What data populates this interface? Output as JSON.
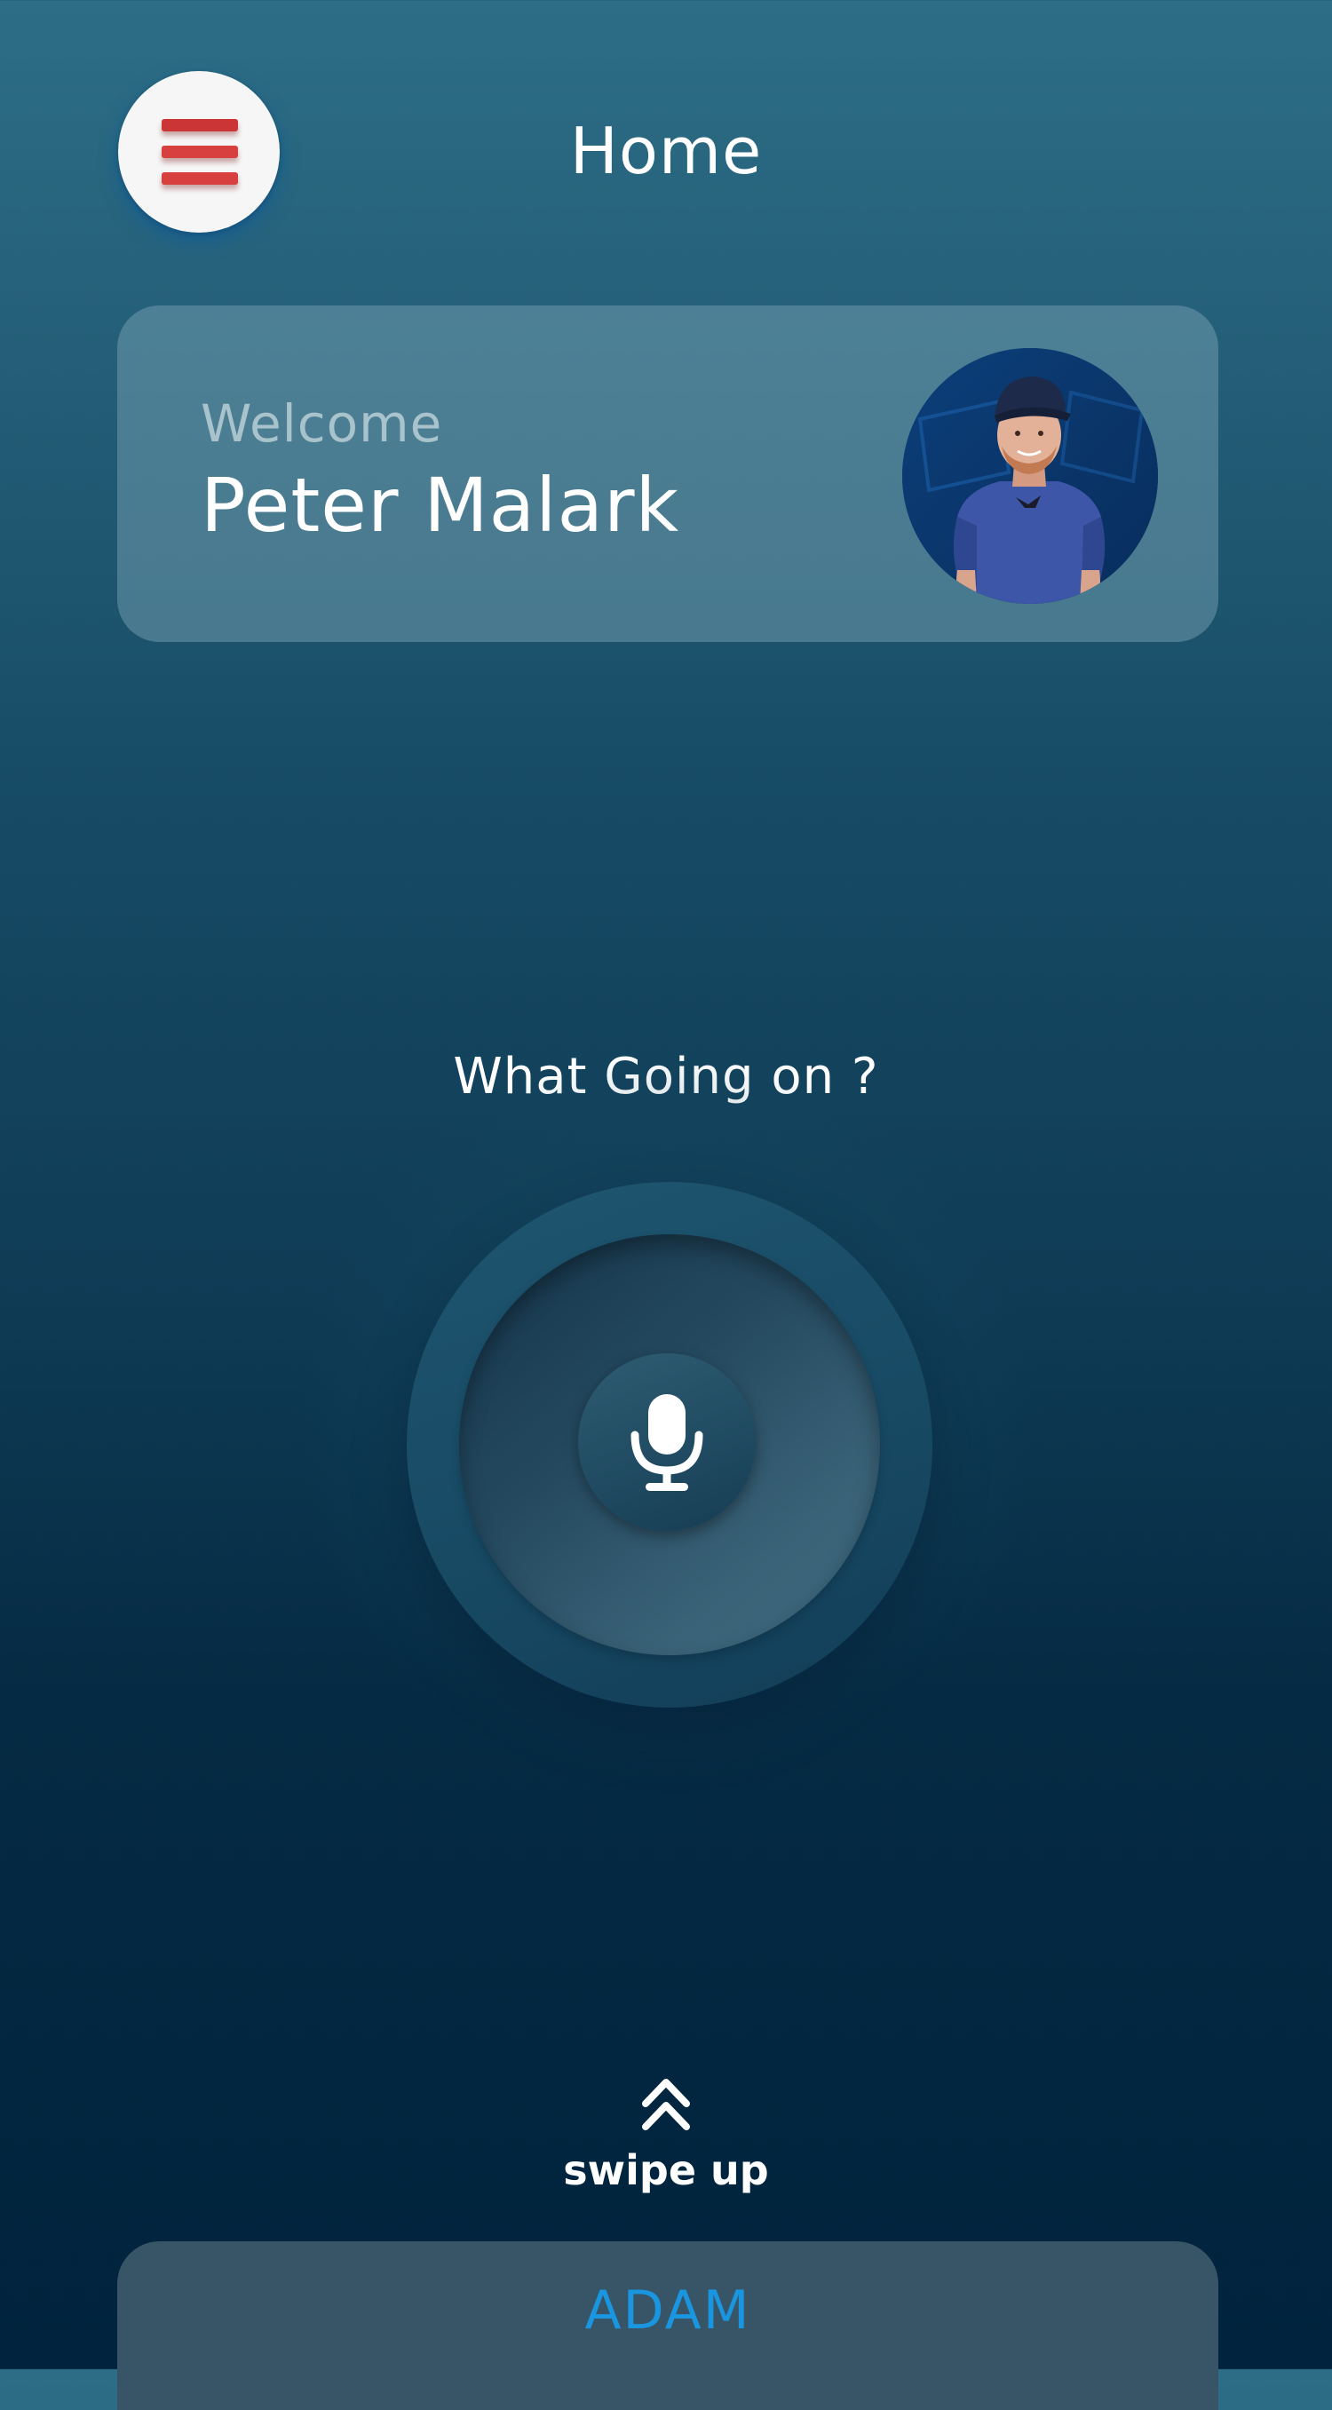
{
  "header": {
    "menu_icon": "hamburger-menu-icon",
    "title": "Home"
  },
  "welcome_card": {
    "greeting": "Welcome",
    "user_name": "Peter Malark",
    "avatar": "user-avatar-photo"
  },
  "voice": {
    "prompt": "What Going on ?",
    "icon": "microphone-icon"
  },
  "swipe": {
    "icon": "double-chevron-up-icon",
    "label": "swipe up"
  },
  "bottom_sheet": {
    "title": "ADAM"
  },
  "colors": {
    "menu_accent": "#d84040",
    "sheet_title": "#1a95e0",
    "background_top": "#2d6e86",
    "background_bottom": "#01233d"
  }
}
